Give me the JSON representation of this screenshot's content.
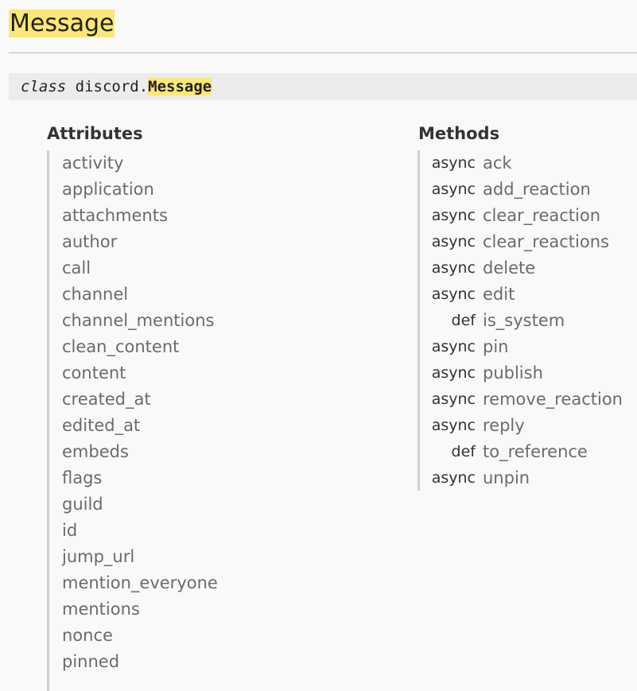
{
  "page": {
    "title": "Message",
    "highlight_color": "#fbe777"
  },
  "class_signature": {
    "keyword": "class",
    "module": "discord.",
    "name": "Message"
  },
  "attributes": {
    "heading": "Attributes",
    "items": [
      "activity",
      "application",
      "attachments",
      "author",
      "call",
      "channel",
      "channel_mentions",
      "clean_content",
      "content",
      "created_at",
      "edited_at",
      "embeds",
      "flags",
      "guild",
      "id",
      "jump_url",
      "mention_everyone",
      "mentions",
      "nonce",
      "pinned"
    ]
  },
  "methods": {
    "heading": "Methods",
    "items": [
      {
        "type": "async",
        "name": "ack"
      },
      {
        "type": "async",
        "name": "add_reaction"
      },
      {
        "type": "async",
        "name": "clear_reaction"
      },
      {
        "type": "async",
        "name": "clear_reactions"
      },
      {
        "type": "async",
        "name": "delete"
      },
      {
        "type": "async",
        "name": "edit"
      },
      {
        "type": "def",
        "name": "is_system"
      },
      {
        "type": "async",
        "name": "pin"
      },
      {
        "type": "async",
        "name": "publish"
      },
      {
        "type": "async",
        "name": "remove_reaction"
      },
      {
        "type": "async",
        "name": "reply"
      },
      {
        "type": "def",
        "name": "to_reference"
      },
      {
        "type": "async",
        "name": "unpin"
      }
    ]
  }
}
